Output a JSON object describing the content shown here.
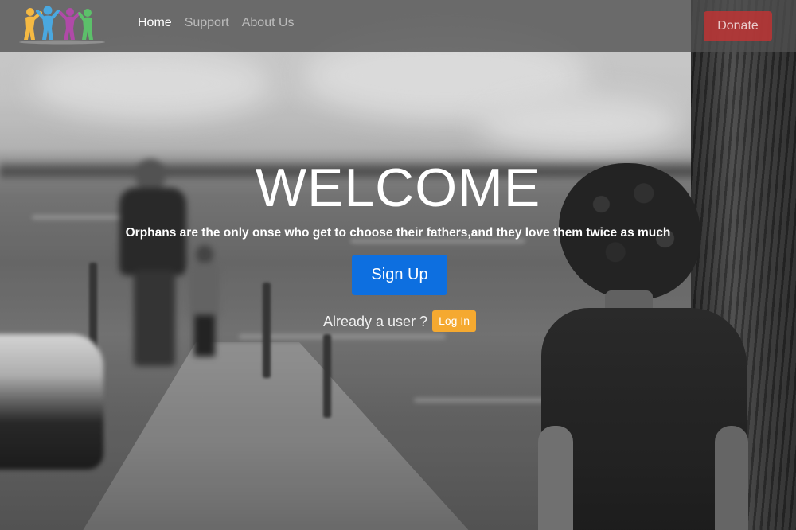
{
  "navbar": {
    "logo_icon": "family-logo-icon",
    "links": [
      {
        "label": "Home",
        "active": true
      },
      {
        "label": "Support",
        "active": false
      },
      {
        "label": "About Us",
        "active": false
      }
    ],
    "donate_label": "Donate"
  },
  "hero": {
    "title": "WELCOME",
    "subtitle": "Orphans are the only onse who get to choose their fathers,and they love them twice as much",
    "signup_label": "Sign Up",
    "login_prompt": "Already a user ?",
    "login_label": "Log In"
  },
  "colors": {
    "navbar_bg": "#505050",
    "donate": "#c83232",
    "signup": "#0d6fe0",
    "login": "#f5a930",
    "logo_figures": [
      "#f5b942",
      "#4aa8e0",
      "#b04aa8",
      "#5cc06a"
    ]
  }
}
